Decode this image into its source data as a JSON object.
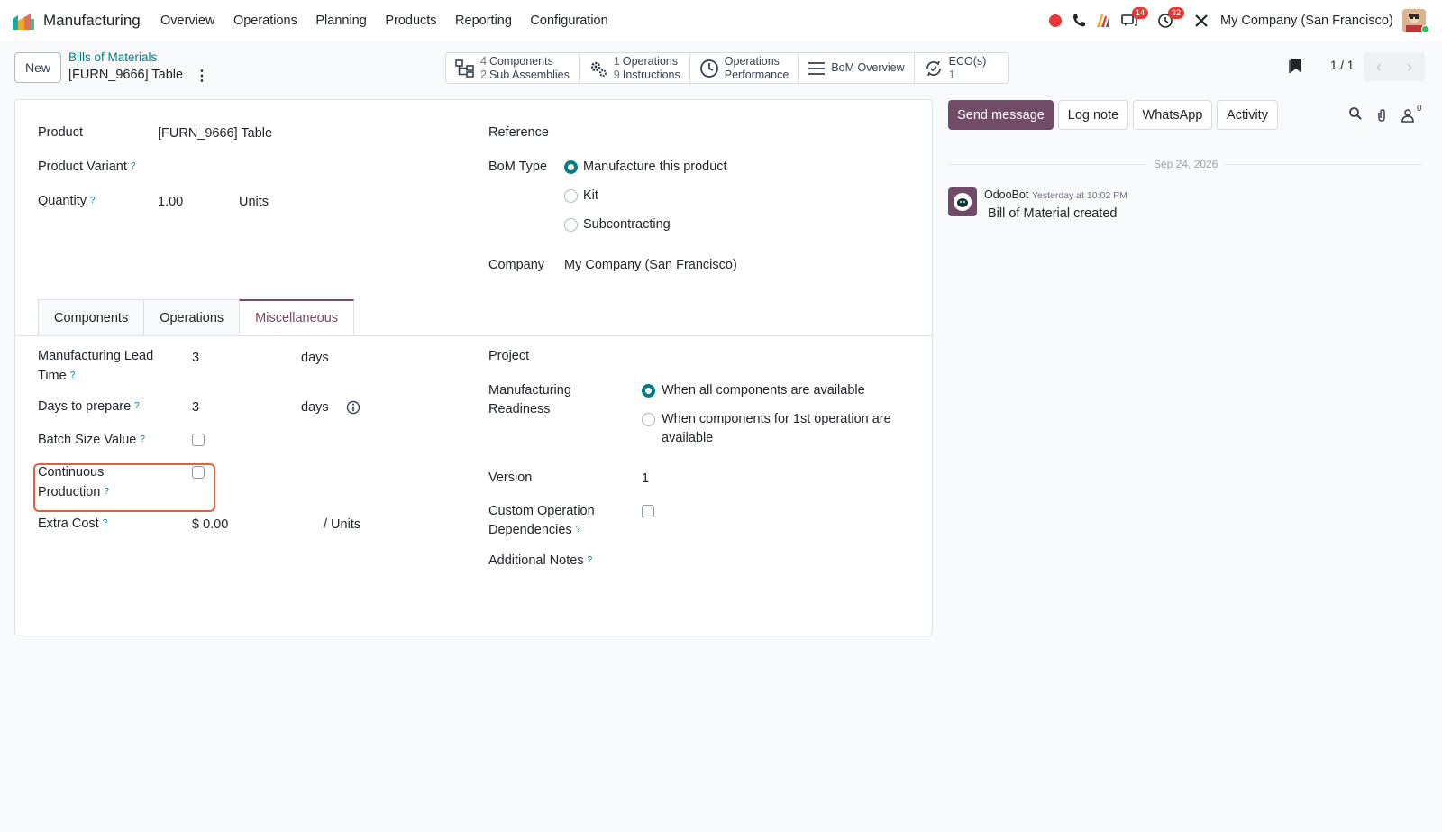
{
  "app": {
    "name": "Manufacturing",
    "menu": [
      "Overview",
      "Operations",
      "Planning",
      "Products",
      "Reporting",
      "Configuration"
    ],
    "brand_color": "#714b67",
    "accent_color": "#017e84"
  },
  "systray": {
    "messages_badge": "14",
    "activities_badge": "32",
    "company": "My Company (San Francisco)"
  },
  "control": {
    "new_label": "New",
    "breadcrumb": "Bills of Materials",
    "record": "[FURN_9666] Table",
    "pager": "1 / 1"
  },
  "smart_buttons": {
    "components_count": "4",
    "components_label": "Components",
    "subassemblies_count": "2",
    "subassemblies_label": "Sub Assemblies",
    "operations_count": "1",
    "operations_label": "Operations",
    "instructions_count": "9",
    "instructions_label": "Instructions",
    "performance_line1": "Operations",
    "performance_line2": "Performance",
    "overview_label": "BoM Overview",
    "eco_label": "ECO(s)",
    "eco_count": "1"
  },
  "form": {
    "product_label": "Product",
    "product_value": "[FURN_9666] Table",
    "variant_label": "Product Variant",
    "quantity_label": "Quantity",
    "quantity_value": "1.00",
    "quantity_uom": "Units",
    "reference_label": "Reference",
    "bom_type_label": "BoM Type",
    "bom_type_options": [
      "Manufacture this product",
      "Kit",
      "Subcontracting"
    ],
    "company_label": "Company",
    "company_value": "My Company (San Francisco)",
    "help_mark": "?"
  },
  "tabs": [
    "Components",
    "Operations",
    "Miscellaneous"
  ],
  "misc": {
    "lead_time_label_1": "Manufacturing Lead",
    "lead_time_label_2": "Time",
    "lead_time_value": "3",
    "lead_time_unit": "days",
    "prepare_label": "Days to prepare",
    "prepare_value": "3",
    "prepare_unit": "days",
    "batch_label": "Batch Size Value",
    "continuous_label_1": "Continuous",
    "continuous_label_2": "Production",
    "extra_cost_label": "Extra Cost",
    "extra_cost_value": "$ 0.00",
    "extra_cost_unit": "/ Units",
    "project_label": "Project",
    "readiness_label_1": "Manufacturing",
    "readiness_label_2": "Readiness",
    "readiness_option_1": "When all components are available",
    "readiness_option_2a": "When components for 1st operation are",
    "readiness_option_2b": "available",
    "version_label": "Version",
    "version_value": "1",
    "custom_dep_label_1": "Custom Operation",
    "custom_dep_label_2": "Dependencies",
    "notes_label": "Additional Notes"
  },
  "chatter": {
    "send_message": "Send message",
    "log_note": "Log note",
    "whatsapp": "WhatsApp",
    "activity": "Activity",
    "followers_count": "0",
    "date": "Sep 24, 2026",
    "author": "OdooBot",
    "time": "Yesterday at 10:02 PM",
    "body": "Bill of Material created"
  }
}
